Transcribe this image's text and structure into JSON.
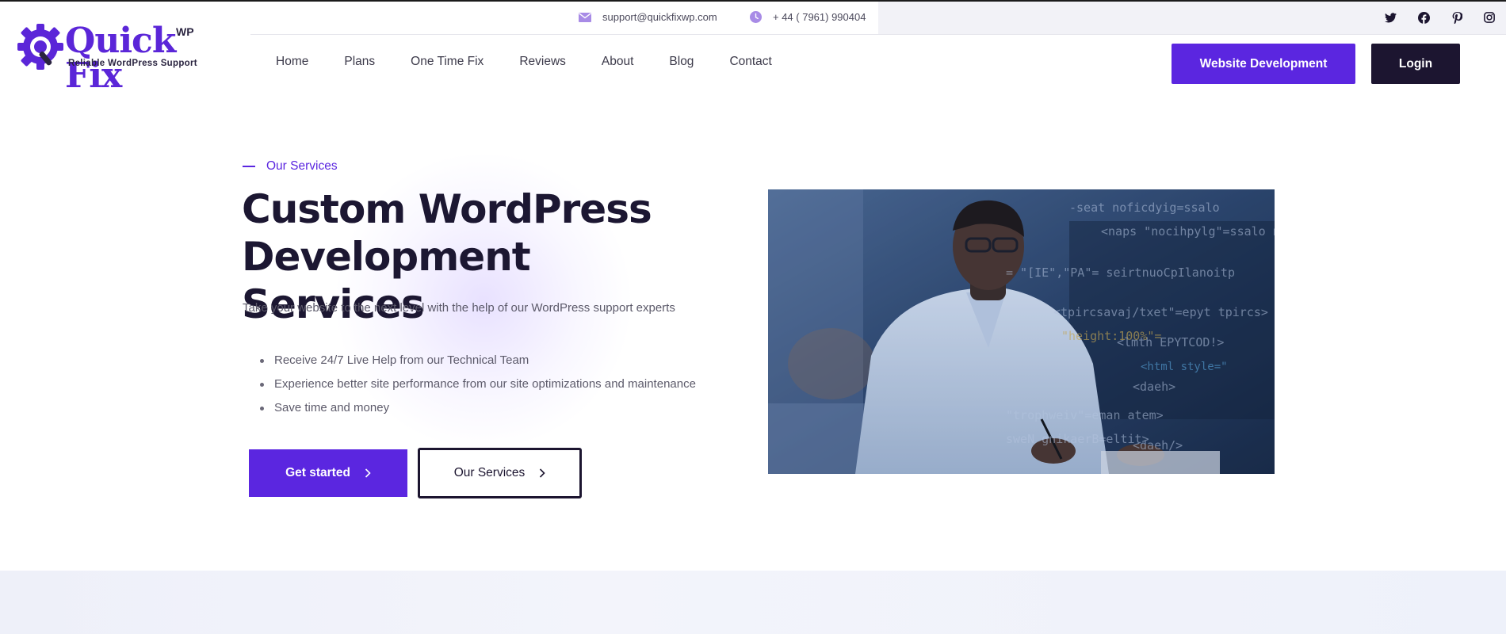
{
  "logo": {
    "word": "Quick Fix",
    "badge": "WP",
    "tagline": "Reliable WordPress Support"
  },
  "topbar": {
    "email": "support@quickfixwp.com",
    "phone": "+ 44 ( 7961) 990404"
  },
  "social": [
    "twitter-icon",
    "facebook-icon",
    "pinterest-icon",
    "instagram-icon"
  ],
  "nav": {
    "items": [
      {
        "label": "Home"
      },
      {
        "label": "Plans"
      },
      {
        "label": "One Time Fix"
      },
      {
        "label": "Reviews"
      },
      {
        "label": "About"
      },
      {
        "label": "Blog"
      },
      {
        "label": "Contact"
      }
    ],
    "cta_label": "Website Development",
    "login_label": "Login"
  },
  "hero": {
    "eyebrow": "Our Services",
    "title": "Custom WordPress Development Services",
    "subtitle": "Take your website to the next level with the help of our WordPress support experts",
    "bullets": [
      "Receive 24/7 Live Help from our Technical Team",
      "Experience better site performance from our site optimizations and maintenance",
      "Save time and money"
    ],
    "primary_cta": "Get started",
    "secondary_cta": "Our Services"
  },
  "colors": {
    "accent": "#5b26e0",
    "dark": "#1c1530",
    "text_muted": "#5c5a6a"
  }
}
